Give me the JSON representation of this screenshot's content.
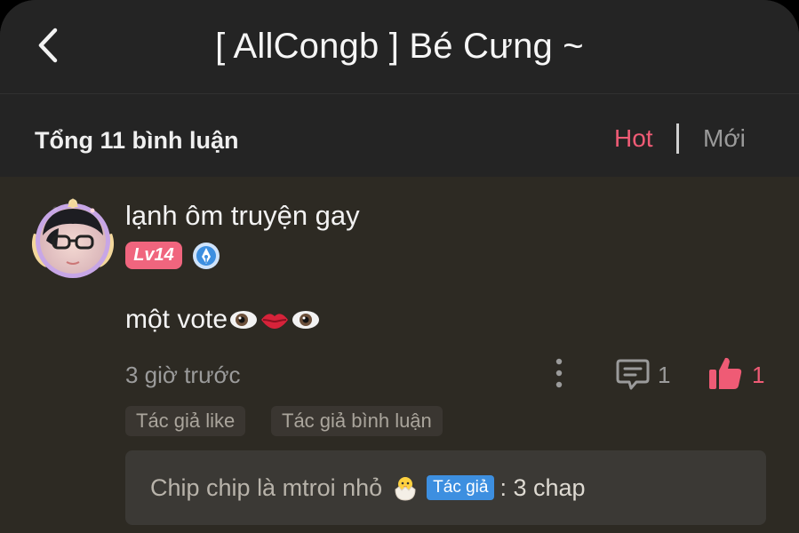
{
  "header": {
    "title": "[ AllCongb ] Bé Cưng ~",
    "back_icon": "chevron-left-icon"
  },
  "subbar": {
    "total_label": "Tổng 11 bình luận",
    "sort_hot": "Hot",
    "sort_new": "Mới",
    "active_sort": "Hot"
  },
  "comment": {
    "username": "lạnh ôm truyện gay",
    "level_badge": "Lv14",
    "verified_icon": "pen-badge-icon",
    "text": "một vote",
    "emojis": [
      "eye-icon",
      "lips-icon",
      "eye-icon"
    ],
    "time": "3 giờ trước",
    "reply_count": "1",
    "like_count": "1",
    "tags": [
      "Tác giả like",
      "Tác giả bình luận"
    ],
    "reply": {
      "author": "Chip chip là mtroi nhỏ",
      "author_emoji": "hatching-chick-icon",
      "author_badge": "Tác giả",
      "content": ": 3 chap"
    }
  },
  "colors": {
    "accent": "#ef5b75",
    "background": "#242424",
    "comment_background": "#2d2a23",
    "author_badge": "#3d8fe0"
  }
}
